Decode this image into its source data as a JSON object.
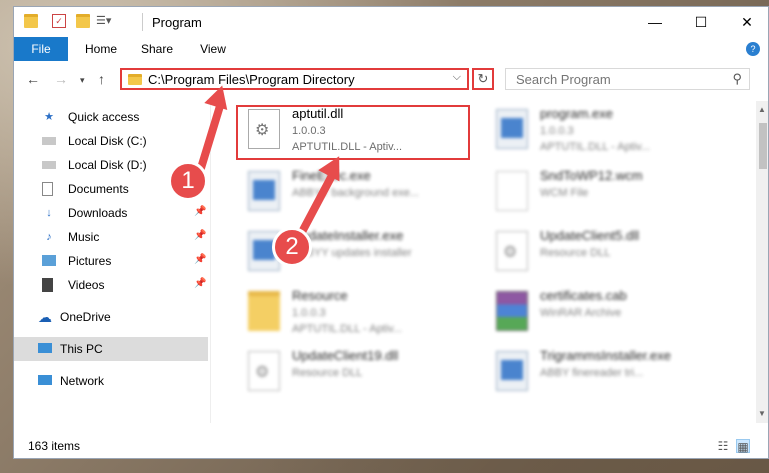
{
  "window": {
    "title": "Program"
  },
  "ribbon": {
    "tabs": [
      "File",
      "Home",
      "Share",
      "View"
    ]
  },
  "address": {
    "path": "C:\\Program Files\\Program Directory"
  },
  "search": {
    "placeholder": "Search Program"
  },
  "sidebar": {
    "items": [
      {
        "label": "Quick access",
        "icon": "star-icon"
      },
      {
        "label": "Local Disk (C:)",
        "icon": "drive-icon"
      },
      {
        "label": "Local Disk (D:)",
        "icon": "drive-icon"
      },
      {
        "label": "Documents",
        "icon": "documents-icon"
      },
      {
        "label": "Downloads",
        "icon": "download-icon",
        "pinned": true
      },
      {
        "label": "Music",
        "icon": "music-icon",
        "pinned": true
      },
      {
        "label": "Pictures",
        "icon": "pictures-icon",
        "pinned": true
      },
      {
        "label": "Videos",
        "icon": "videos-icon",
        "pinned": true
      },
      {
        "label": "OneDrive",
        "icon": "cloud-icon"
      },
      {
        "label": "This PC",
        "icon": "computer-icon",
        "selected": true
      },
      {
        "label": "Network",
        "icon": "network-icon"
      }
    ]
  },
  "files": [
    {
      "name": "aptutil.dll",
      "line2": "1.0.0.3",
      "line3": "APTUTIL.DLL - Aptiv...",
      "icon": "gear-file-icon",
      "highlighted": true
    },
    {
      "name": "program.exe",
      "line2": "1.0.0.3",
      "line3": "APTUTIL.DLL - Aptiv...",
      "icon": "app-icon"
    },
    {
      "name": "FineExec.exe",
      "line2": "ABBYY background exe...",
      "line3": "",
      "icon": "app-icon"
    },
    {
      "name": "SndToWP12.wcm",
      "line2": "WCM File",
      "line3": "",
      "icon": "document-icon"
    },
    {
      "name": "UpdateInstaller.exe",
      "line2": "ABBYY updates installer",
      "line3": "",
      "icon": "app-icon"
    },
    {
      "name": "UpdateClient5.dll",
      "line2": "Resource DLL",
      "line3": "",
      "icon": "gear-file-icon"
    },
    {
      "name": "Resource",
      "line2": "1.0.0.3",
      "line3": "APTUTIL.DLL - Aptiv...",
      "icon": "folder-icon"
    },
    {
      "name": "certificates.cab",
      "line2": "WinRAR Archive",
      "line3": "",
      "icon": "archive-icon"
    },
    {
      "name": "UpdateClient19.dll",
      "line2": "Resource DLL",
      "line3": "",
      "icon": "gear-file-icon"
    },
    {
      "name": "TrigrammsInstaller.exe",
      "line2": "ABBY finereader tri...",
      "line3": "",
      "icon": "app-icon"
    }
  ],
  "status": {
    "items": "163 items"
  },
  "callouts": [
    "1",
    "2"
  ],
  "colors": {
    "accent": "#1979ca",
    "highlight": "#e23b3b",
    "arrow": "#e74c4c"
  }
}
